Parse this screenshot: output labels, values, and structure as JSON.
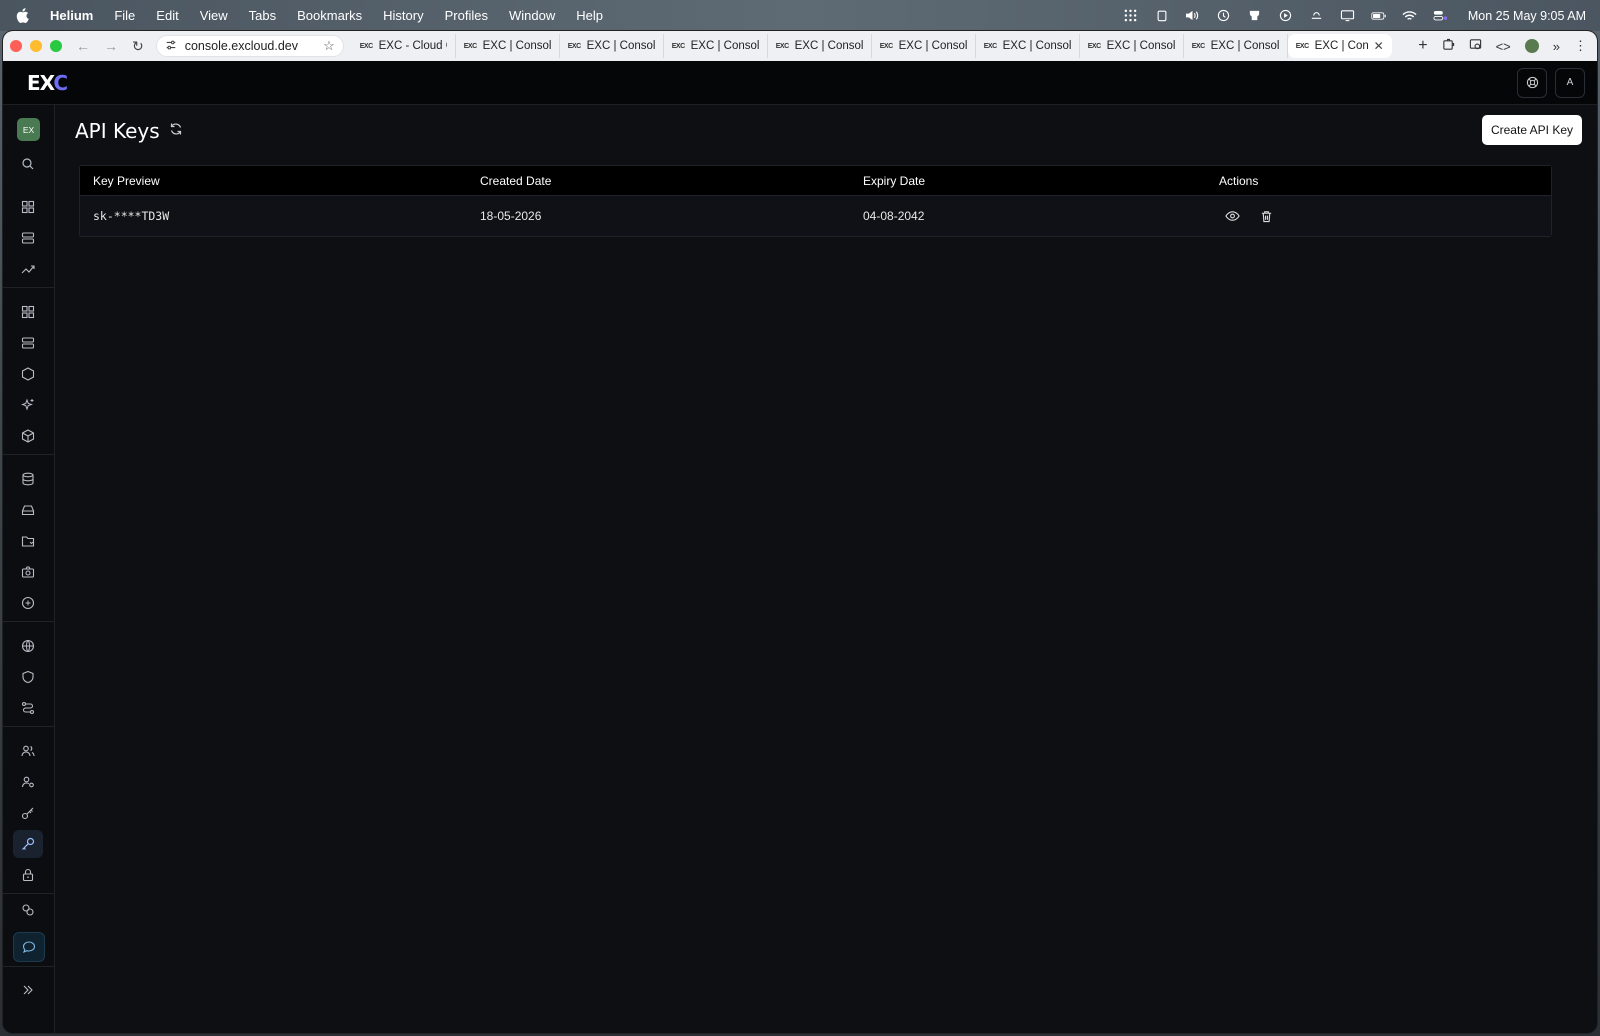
{
  "menubar": {
    "app": "Helium",
    "items": [
      "File",
      "Edit",
      "View",
      "Tabs",
      "Bookmarks",
      "History",
      "Profiles",
      "Window",
      "Help"
    ],
    "clock": "Mon 25 May  9:05 AM"
  },
  "browser": {
    "url": "console.excloud.dev",
    "tabs": [
      {
        "favicon": "EXC",
        "label": "EXC - Cloud Co"
      },
      {
        "favicon": "EXC",
        "label": "EXC | Console"
      },
      {
        "favicon": "EXC",
        "label": "EXC | Console"
      },
      {
        "favicon": "EXC",
        "label": "EXC | Console"
      },
      {
        "favicon": "EXC",
        "label": "EXC | Console"
      },
      {
        "favicon": "EXC",
        "label": "EXC | Console"
      },
      {
        "favicon": "EXC",
        "label": "EXC | Console"
      },
      {
        "favicon": "EXC",
        "label": "EXC | Console"
      },
      {
        "favicon": "EXC",
        "label": "EXC | Console"
      },
      {
        "favicon": "EXC",
        "label": "EXC | Cons"
      }
    ]
  },
  "app": {
    "logo_main": "EX",
    "logo_accent": "C",
    "user_initial": "A",
    "org_badge": "EX"
  },
  "page": {
    "title": "API Keys",
    "create_button": "Create API Key"
  },
  "table": {
    "headers": [
      "Key Preview",
      "Created Date",
      "Expiry Date",
      "Actions"
    ],
    "rows": [
      {
        "key": "sk-****TD3W",
        "created": "18-05-2026",
        "expiry": "04-08-2042"
      }
    ]
  },
  "colors": {
    "accent": "#6e6ef7",
    "org_badge": "#4a7a52",
    "bg": "#0d0f13"
  }
}
